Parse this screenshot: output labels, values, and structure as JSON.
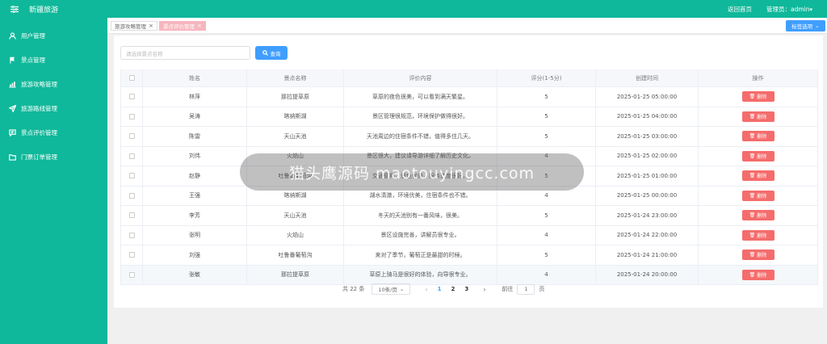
{
  "header": {
    "title": "新疆旅游",
    "home_link": "返回首页",
    "admin_label": "管理员：admin",
    "caret": "▾"
  },
  "sidebar": {
    "items": [
      {
        "label": "用户管理",
        "icon": "user-icon"
      },
      {
        "label": "景点管理",
        "icon": "flag-icon"
      },
      {
        "label": "旅游攻略管理",
        "icon": "chart-icon"
      },
      {
        "label": "旅游路线管理",
        "icon": "send-icon"
      },
      {
        "label": "景点评价管理",
        "icon": "comment-icon"
      },
      {
        "label": "门票订单管理",
        "icon": "folder-icon"
      }
    ]
  },
  "tabs": [
    {
      "label": "旅游攻略管理",
      "active": false
    },
    {
      "label": "景点评价管理",
      "active": true
    }
  ],
  "tab_options_label": "标签选项",
  "search": {
    "placeholder": "请选择景点名称",
    "button_label": "查询"
  },
  "table": {
    "headers": [
      "姓名",
      "景点名称",
      "评价内容",
      "评分(1-5分)",
      "创建时间",
      "操作"
    ],
    "delete_label": "删除",
    "rows": [
      {
        "name": "林萍",
        "spot": "那拉提草原",
        "content": "草原的夜色很美，可以看到满天繁星。",
        "score": "5",
        "time": "2025-01-25 05:00:00"
      },
      {
        "name": "吴涛",
        "spot": "喀纳斯湖",
        "content": "景区管理很规范，环境保护做得很好。",
        "score": "5",
        "time": "2025-01-25 04:00:00"
      },
      {
        "name": "陈雷",
        "spot": "天山天池",
        "content": "天池周边的住宿条件不错，值得多住几天。",
        "score": "5",
        "time": "2025-01-25 03:00:00"
      },
      {
        "name": "刘伟",
        "spot": "火焰山",
        "content": "景区很大，建议请导游详细了解历史文化。",
        "score": "4",
        "time": "2025-01-25 02:00:00"
      },
      {
        "name": "赵静",
        "spot": "吐鲁番葡萄沟",
        "content": "交通便利，景色优美，服务态度很好。",
        "score": "5",
        "time": "2025-01-25 01:00:00"
      },
      {
        "name": "王强",
        "spot": "喀纳斯湖",
        "content": "湖水清澈，环境优美，住宿条件也不错。",
        "score": "4",
        "time": "2025-01-25 00:00:00"
      },
      {
        "name": "李芳",
        "spot": "天山天池",
        "content": "冬天的天池别有一番风味，很美。",
        "score": "5",
        "time": "2025-01-24 23:00:00"
      },
      {
        "name": "张明",
        "spot": "火焰山",
        "content": "景区设施完善，讲解员很专业。",
        "score": "4",
        "time": "2025-01-24 22:00:00"
      },
      {
        "name": "刘强",
        "spot": "吐鲁番葡萄沟",
        "content": "来对了季节，葡萄正是最甜的时候。",
        "score": "5",
        "time": "2025-01-24 21:00:00"
      },
      {
        "name": "张敏",
        "spot": "那拉提草原",
        "content": "草原上骑马是很好的体验，向导很专业。",
        "score": "4",
        "time": "2025-01-24 20:00:00"
      }
    ]
  },
  "pagination": {
    "total": "共 22 条",
    "page_size": "10条/页",
    "prev": "‹",
    "next": "›",
    "pages": [
      "1",
      "2",
      "3"
    ],
    "current": "1",
    "goto_label": "前往",
    "goto_value": "1",
    "page_suffix": "页"
  },
  "watermark": "猫头鹰源码 maotouyingcc.com"
}
